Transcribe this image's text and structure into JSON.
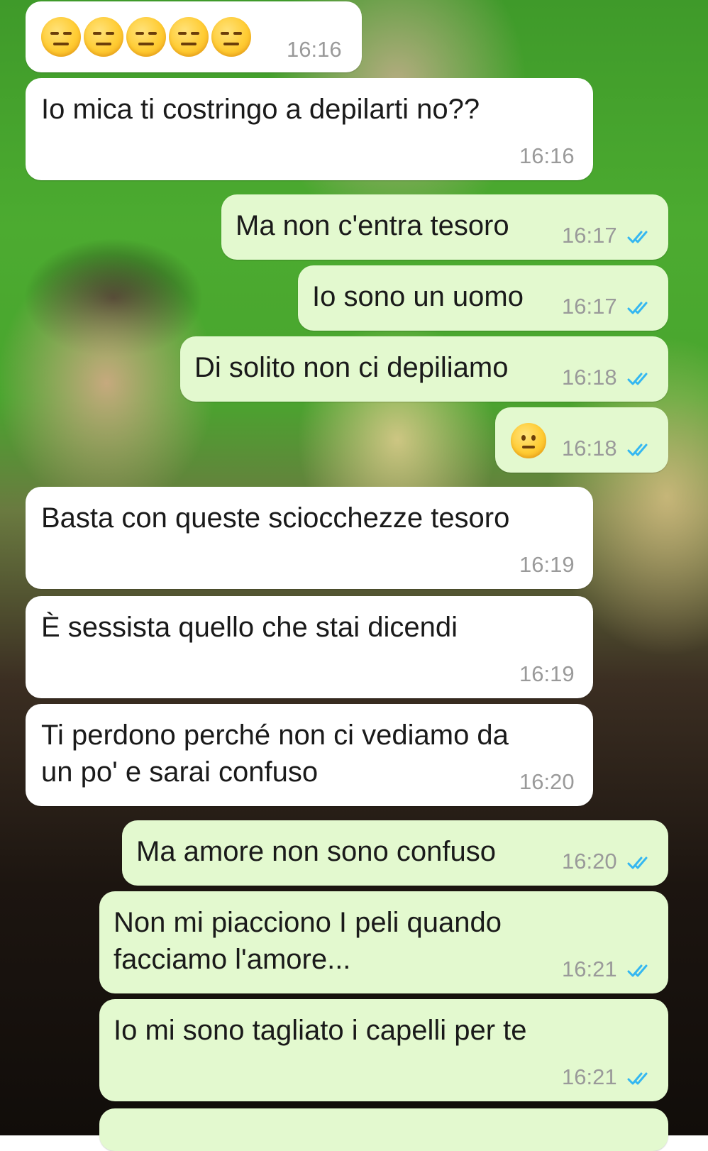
{
  "messages": [
    {
      "direction": "in",
      "text": "",
      "emoji": [
        "expressionless-face",
        "expressionless-face",
        "expressionless-face",
        "expressionless-face",
        "expressionless-face"
      ],
      "time": "16:16"
    },
    {
      "direction": "in",
      "text": "Io mica ti costringo a depilarti no??",
      "time": "16:16"
    },
    {
      "direction": "out",
      "text": "Ma non c'entra tesoro",
      "time": "16:17",
      "status": "read"
    },
    {
      "direction": "out",
      "text": "Io sono un uomo",
      "time": "16:17",
      "status": "read"
    },
    {
      "direction": "out",
      "text": "Di solito non ci depiliamo",
      "time": "16:18",
      "status": "read"
    },
    {
      "direction": "out",
      "text": "",
      "emoji": [
        "neutral-face"
      ],
      "time": "16:18",
      "status": "read"
    },
    {
      "direction": "in",
      "text": "Basta con queste sciocchezze tesoro",
      "time": "16:19"
    },
    {
      "direction": "in",
      "text": "È sessista quello che stai dicendi",
      "time": "16:19"
    },
    {
      "direction": "in",
      "text_lines": [
        "Ti perdono perché non ci vediamo da",
        "un po' e sarai confuso"
      ],
      "time": "16:20"
    },
    {
      "direction": "out",
      "text": "Ma amore non sono confuso",
      "time": "16:20",
      "status": "read"
    },
    {
      "direction": "out",
      "text_lines": [
        "Non mi piacciono I peli quando",
        "facciamo l'amore..."
      ],
      "time": "16:21",
      "status": "read"
    },
    {
      "direction": "out",
      "text": "Io mi sono tagliato i capelli per te",
      "time": "16:21",
      "status": "read"
    }
  ],
  "colors": {
    "incoming_bubble": "#ffffff",
    "outgoing_bubble": "#e3f9cf",
    "timestamp": "#9a9a9a",
    "read_ticks": "#34b7f1",
    "wallpaper": "#4cab30"
  }
}
